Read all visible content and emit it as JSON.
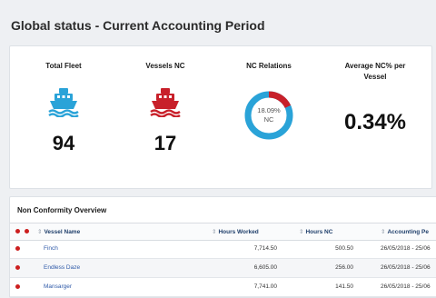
{
  "page_title": "Global status - Current Accounting Period",
  "stats": {
    "total_fleet": {
      "title": "Total Fleet",
      "value": "94",
      "icon": "ship-icon",
      "color": "#2aa3d8"
    },
    "vessels_nc": {
      "title": "Vessels NC",
      "value": "17",
      "icon": "ship-icon",
      "color": "#c8202a"
    },
    "nc_relations": {
      "title": "NC Relations",
      "percent_label": "18.09%",
      "sub_label": "NC",
      "fraction": 0.1809,
      "ring_color": "#2aa3d8",
      "nc_color": "#c8202a"
    },
    "avg_nc": {
      "title_line1": "Average NC% per",
      "title_line2": "Vessel",
      "value": "0.34%"
    }
  },
  "table": {
    "title": "Non Conformity Overview",
    "columns": {
      "vessel_name": "Vessel Name",
      "hours_worked": "Hours Worked",
      "hours_nc": "Hours NC",
      "accounting_period": "Accounting Pe"
    },
    "rows": [
      {
        "vessel": "Finch",
        "hours_worked": "7,714.50",
        "hours_nc": "500.50",
        "period": "26/05/2018 - 25/06"
      },
      {
        "vessel": "Endless Daze",
        "hours_worked": "6,605.00",
        "hours_nc": "256.00",
        "period": "26/05/2018 - 25/06"
      },
      {
        "vessel": "Mansarger",
        "hours_worked": "7,741.00",
        "hours_nc": "141.50",
        "period": "26/05/2018 - 25/06"
      }
    ]
  }
}
